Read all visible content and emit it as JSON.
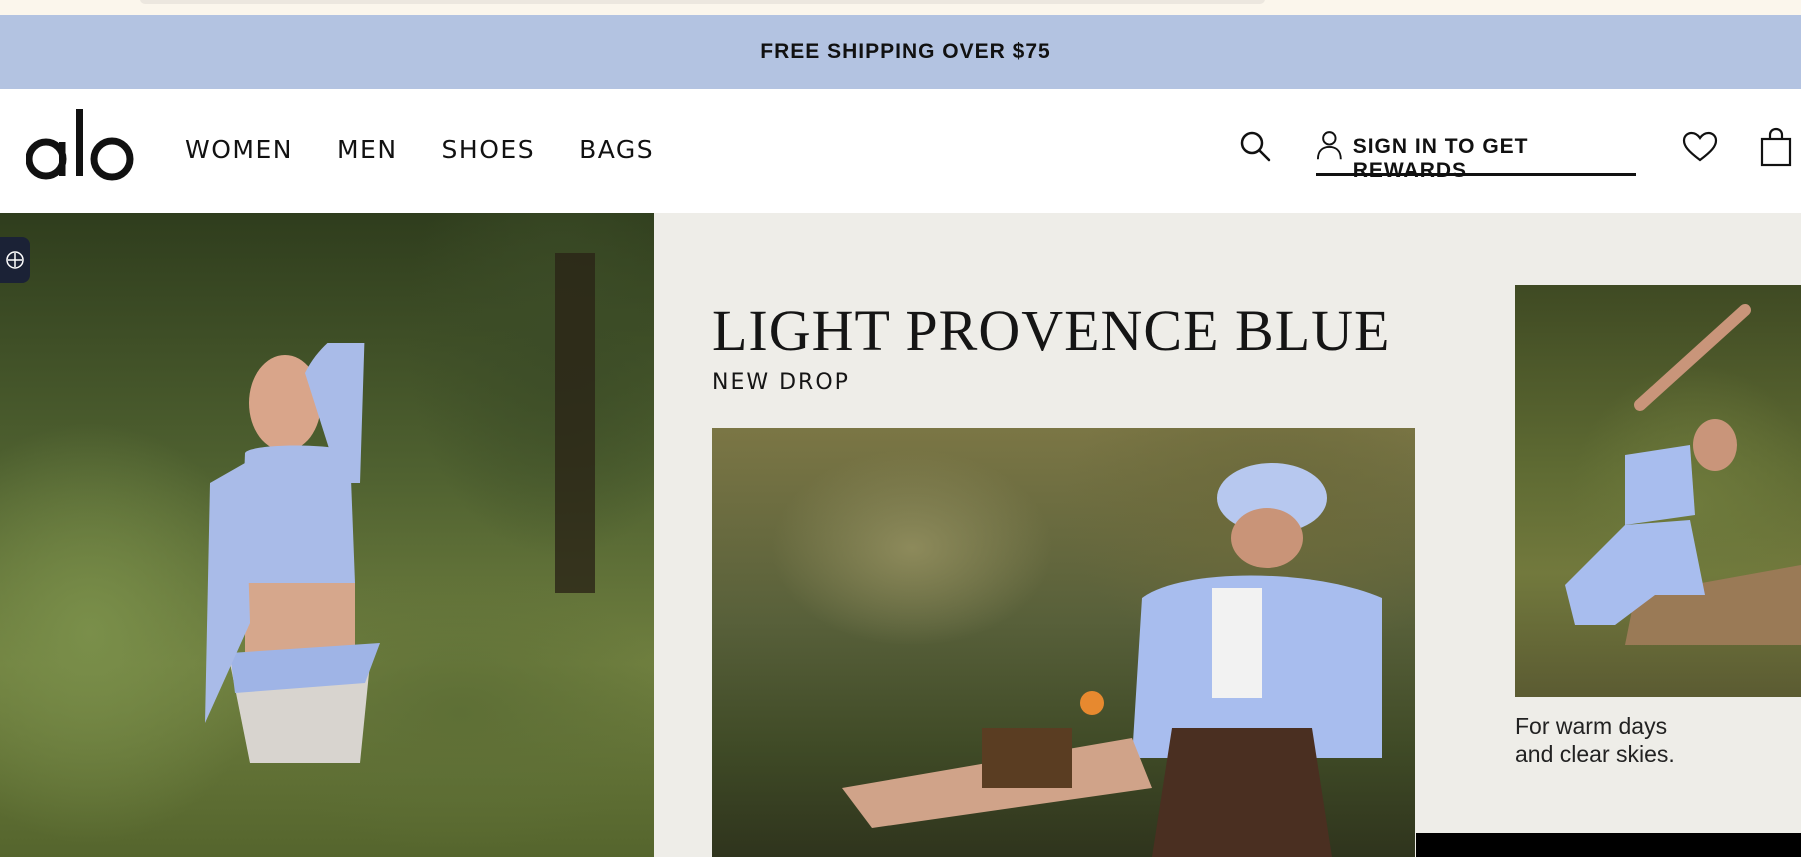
{
  "promo": {
    "text": "FREE SHIPPING OVER $75",
    "bg": "#b3c3e1"
  },
  "nav": {
    "logo_text": "alo",
    "menu": [
      "WOMEN",
      "MEN",
      "SHOES",
      "BAGS"
    ],
    "signin_label": "SIGN IN TO GET REWARDS",
    "icons": [
      "search-icon",
      "user-icon",
      "heart-icon",
      "shopping-bag-icon"
    ]
  },
  "hero": {
    "headline": "LIGHT PROVENCE BLUE",
    "subhead": "NEW DROP",
    "caption_lines": [
      "For warm days",
      "and clear skies."
    ]
  },
  "colors": {
    "accent_blue": "#b3c3e1",
    "apparel_blue": "#9fb4e6",
    "panel_bg": "#eeede8"
  }
}
